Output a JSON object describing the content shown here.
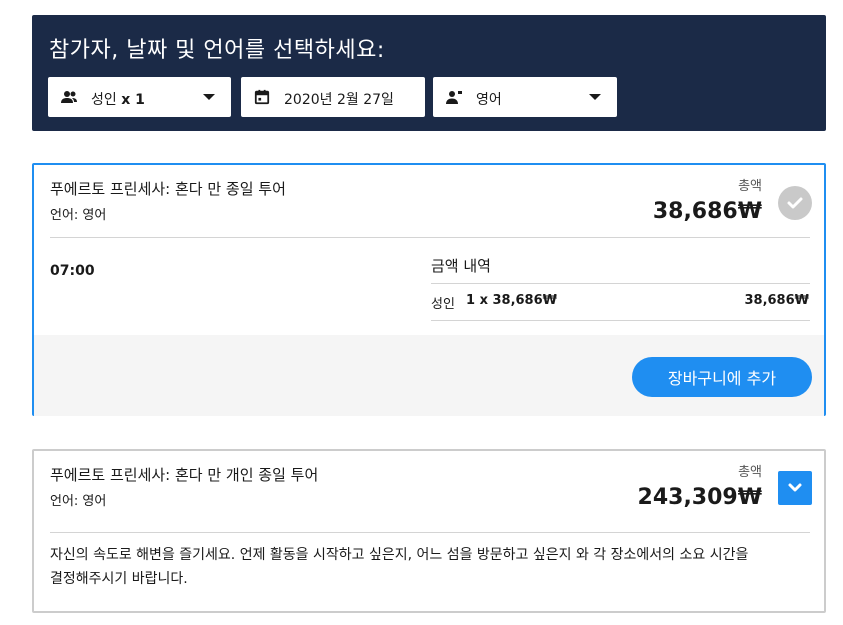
{
  "header": {
    "title": "참가자, 날짜 및 언어를 선택하세요:",
    "participants": {
      "label": "성인",
      "count": "x 1",
      "icon": "users-icon"
    },
    "date": {
      "value": "2020년 2월 27일",
      "icon": "calendar-icon"
    },
    "language": {
      "value": "영어",
      "icon": "language-icon"
    }
  },
  "tours": [
    {
      "title": "푸에르토 프린세사: 혼다 만 종일 투어",
      "language": "언어: 영어",
      "total_label": "총액",
      "total_price": "38,686₩",
      "time": "07:00",
      "breakdown_title": "금액 내역",
      "breakdown_label": "성인",
      "breakdown_qty": "1 x 38,686₩",
      "breakdown_sum": "38,686₩",
      "add_to_cart": "장바구니에 추가",
      "status_icon": "check-icon"
    },
    {
      "title": "푸에르토 프린세사: 혼다 만 개인 종일 투어",
      "language": "언어: 영어",
      "total_label": "총액",
      "total_price": "243,309₩",
      "description": "자신의 속도로 해변을 즐기세요. 언제 활동을 시작하고 싶은지, 어느 섬을 방문하고 싶은지 와 각 장소에서의 소요 시간을 결정해주시기 바랍니다.",
      "expand_icon": "chevron-down-icon"
    }
  ],
  "colors": {
    "header_bg": "#1b2a47",
    "accent": "#1f8ef1",
    "muted_bg": "#f5f5f5"
  }
}
